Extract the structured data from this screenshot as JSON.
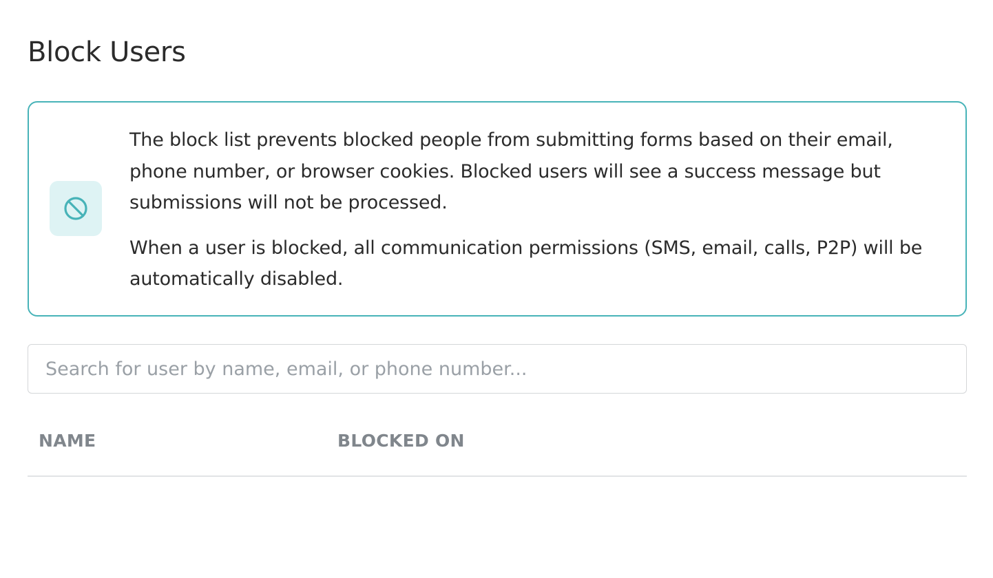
{
  "page": {
    "title": "Block Users"
  },
  "info_box": {
    "icon": "block-icon",
    "paragraph_1": "The block list prevents blocked people from submitting forms based on their email, phone number, or browser cookies. Blocked users will see a success message but submissions will not be processed.",
    "paragraph_2": "When a user is blocked, all communication permissions (SMS, email, calls, P2P) will be automatically disabled."
  },
  "search": {
    "value": "",
    "placeholder": "Search for user by name, email, or phone number..."
  },
  "table": {
    "columns": [
      "NAME",
      "BLOCKED ON"
    ],
    "rows": []
  },
  "colors": {
    "accent": "#47b3b8",
    "icon_background": "#def3f4",
    "header_text": "#80868c"
  }
}
